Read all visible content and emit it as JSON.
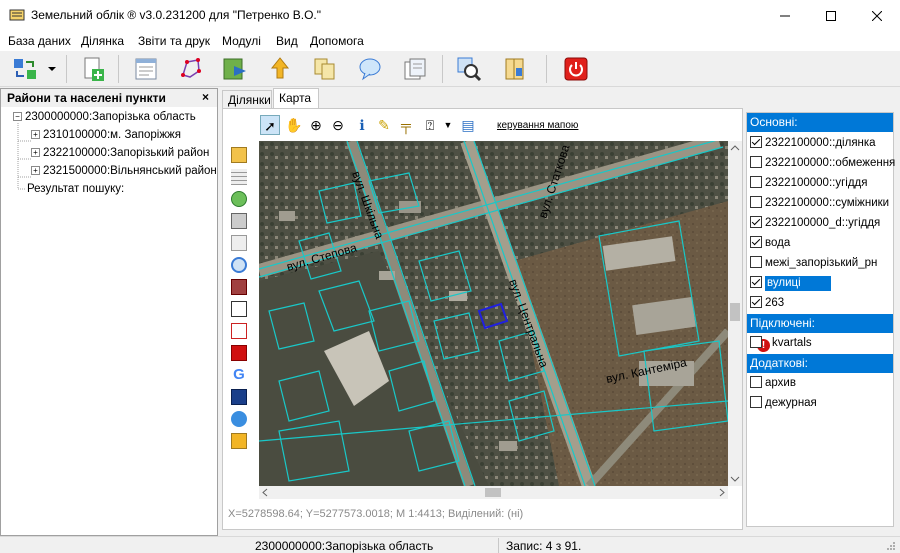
{
  "window": {
    "title": "Земельний облік ® v3.0.231200 для \"Петренко В.О.\""
  },
  "menu": [
    "База даних",
    "Ділянка",
    "Звіти та друк",
    "Модулі",
    "Вид",
    "Допомога"
  ],
  "toolbar_icons": [
    "sync-icon",
    "dropdown-arrow-icon",
    "add-parcel-icon",
    "document-icon",
    "polygon-icon",
    "map-export-icon",
    "upload-icon",
    "copy-icon",
    "chat-icon",
    "forms-icon",
    "search-zoom-icon",
    "archive-icon",
    "power-icon"
  ],
  "left_panel": {
    "title": "Райони та населені пункти",
    "close": "×",
    "tree": [
      {
        "label": "2300000000:Запорізька область",
        "level": 0,
        "expander": "−"
      },
      {
        "label": "2310100000:м. Запоріжжя",
        "level": 1,
        "expander": "+"
      },
      {
        "label": "2322100000:Запорізький район",
        "level": 1,
        "expander": "+"
      },
      {
        "label": "2321500000:Вільнянський район",
        "level": 1,
        "expander": "+"
      },
      {
        "label": "Результат пошуку:",
        "level": 0,
        "expander": ""
      }
    ]
  },
  "tabs": [
    {
      "label": "Ділянки",
      "active": false
    },
    {
      "label": "Карта",
      "active": true
    }
  ],
  "map_toolbar": {
    "control_link": "керування мапою"
  },
  "map": {
    "street_labels": [
      "вул. Статкова",
      "вул. Степова",
      "вул. Шкільна",
      "вул. Центральна",
      "вул. Кантеміра"
    ]
  },
  "coords_text": "X=5278598.64; Y=5277573.0018; M 1:4413; Виділений: (ні)",
  "layers": {
    "main_header": "Основні:",
    "main": [
      {
        "label": "2322100000::ділянка",
        "checked": true,
        "selected": false
      },
      {
        "label": "2322100000::обмеження",
        "checked": false,
        "selected": false
      },
      {
        "label": "2322100000::угіддя",
        "checked": false,
        "selected": false
      },
      {
        "label": "2322100000::суміжники",
        "checked": false,
        "selected": false
      },
      {
        "label": "2322100000_d::угіддя",
        "checked": true,
        "selected": false
      },
      {
        "label": "вода",
        "checked": true,
        "selected": false
      },
      {
        "label": "межі_запорізький_рн",
        "checked": false,
        "selected": false
      },
      {
        "label": "вулиці",
        "checked": true,
        "selected": true
      },
      {
        "label": "263",
        "checked": true,
        "selected": false
      }
    ],
    "connected_header": "Підключені:",
    "connected": [
      {
        "label": "kvartals",
        "checked": false,
        "warning": "!"
      }
    ],
    "extra_header": "Додаткові:",
    "extra": [
      {
        "label": "архив",
        "checked": false
      },
      {
        "label": "дежурная",
        "checked": false
      }
    ]
  },
  "status": {
    "region": "2300000000:Запорізька область",
    "record": "Запис: 4  з 91."
  }
}
